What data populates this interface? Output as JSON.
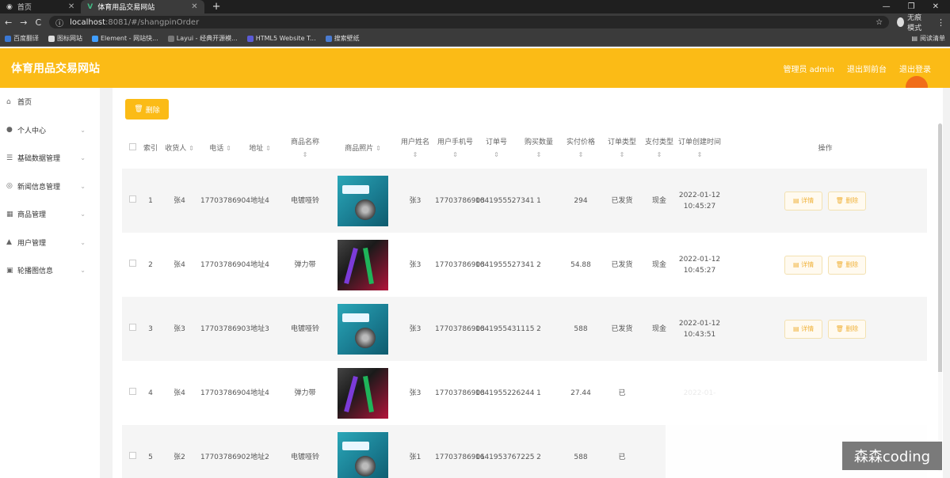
{
  "browser": {
    "tabs": [
      {
        "label": "首页"
      },
      {
        "label": "体育用品交易网站"
      }
    ],
    "url_host": "localhost",
    "url_rest": ":8081/#/shangpinOrder",
    "profile": "无痕模式",
    "bookmarks": [
      "百度翻译",
      "图标网站",
      "Element - 网站快...",
      "Layui - 经典开源模...",
      "HTML5 Website T...",
      "搜索壁纸"
    ],
    "bookmarks_right": "阅读清单"
  },
  "header": {
    "title": "体育用品交易网站",
    "admin_label": "管理员 admin",
    "back_label": "退出到前台",
    "logout_label": "退出登录"
  },
  "sidebar": {
    "items": [
      {
        "label": "首页",
        "icon": "home-icon"
      },
      {
        "label": "个人中心",
        "icon": "user-icon"
      },
      {
        "label": "基础数据管理",
        "icon": "settings-icon"
      },
      {
        "label": "新闻信息管理",
        "icon": "news-icon"
      },
      {
        "label": "商品管理",
        "icon": "goods-icon"
      },
      {
        "label": "用户管理",
        "icon": "users-icon"
      },
      {
        "label": "轮播图信息",
        "icon": "image-icon"
      }
    ]
  },
  "toolbar": {
    "delete_label": "删除"
  },
  "table": {
    "headers": {
      "index": "索引",
      "receiver": "收货人",
      "phone": "电话",
      "address": "地址",
      "product": "商品名称",
      "photo": "商品照片",
      "username": "用户姓名",
      "user_phone": "用户手机号",
      "order_no": "订单号",
      "qty": "购买数量",
      "price": "实付价格",
      "order_type": "订单类型",
      "pay_type": "支付类型",
      "created": "订单创建时间",
      "actions": "操作"
    },
    "actions": {
      "detail": "详情",
      "delete": "删除"
    },
    "rows": [
      {
        "index": "1",
        "receiver": "张4",
        "phone": "17703786904",
        "address": "地址4",
        "product": "电镀哑铃",
        "image": "teal",
        "username": "张3",
        "user_phone": "17703786903",
        "order_no": "1641955527341",
        "qty": "1",
        "price": "294",
        "order_type": "已发货",
        "pay_type": "现金",
        "created": "2022-01-12 10:45:27"
      },
      {
        "index": "2",
        "receiver": "张4",
        "phone": "17703786904",
        "address": "地址4",
        "product": "弹力带",
        "image": "red",
        "username": "张3",
        "user_phone": "17703786903",
        "order_no": "1641955527341",
        "qty": "2",
        "price": "54.88",
        "order_type": "已发货",
        "pay_type": "现金",
        "created": "2022-01-12 10:45:27"
      },
      {
        "index": "3",
        "receiver": "张3",
        "phone": "17703786903",
        "address": "地址3",
        "product": "电镀哑铃",
        "image": "teal",
        "username": "张3",
        "user_phone": "17703786903",
        "order_no": "1641955431115",
        "qty": "2",
        "price": "588",
        "order_type": "已发货",
        "pay_type": "现金",
        "created": "2022-01-12 10:43:51"
      },
      {
        "index": "4",
        "receiver": "张4",
        "phone": "17703786904",
        "address": "地址4",
        "product": "弹力带",
        "image": "red",
        "username": "张3",
        "user_phone": "17703786903",
        "order_no": "1641955226244",
        "qty": "1",
        "price": "27.44",
        "order_type": "已",
        "pay_type": "",
        "created": "2022-01-"
      },
      {
        "index": "5",
        "receiver": "张2",
        "phone": "17703786902",
        "address": "地址2",
        "product": "电镀哑铃",
        "image": "teal",
        "username": "张1",
        "user_phone": "17703786901",
        "order_no": "1641953767225",
        "qty": "2",
        "price": "588",
        "order_type": "已",
        "pay_type": "",
        "created": ""
      }
    ]
  },
  "watermark": "森森coding",
  "colors": {
    "accent": "#fbbb16"
  }
}
